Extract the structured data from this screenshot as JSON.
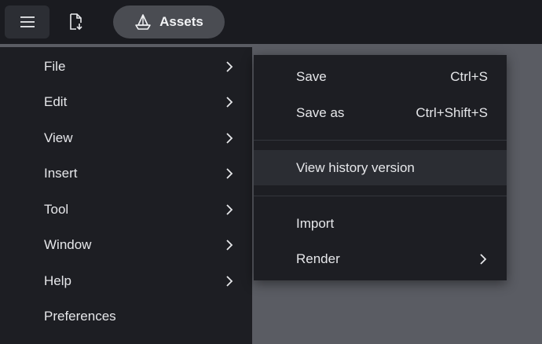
{
  "topbar": {
    "menu_icon": "hamburger-icon",
    "export_icon": "file-export-icon",
    "assets_icon": "boat-icon",
    "assets_label": "Assets"
  },
  "main_menu": {
    "items": [
      {
        "label": "File",
        "has_submenu": true
      },
      {
        "label": "Edit",
        "has_submenu": true
      },
      {
        "label": "View",
        "has_submenu": true
      },
      {
        "label": "Insert",
        "has_submenu": true
      },
      {
        "label": "Tool",
        "has_submenu": true
      },
      {
        "label": "Window",
        "has_submenu": true
      },
      {
        "label": "Help",
        "has_submenu": true
      },
      {
        "label": "Preferences",
        "has_submenu": false
      }
    ]
  },
  "file_submenu": {
    "save": {
      "label": "Save",
      "shortcut": "Ctrl+S"
    },
    "save_as": {
      "label": "Save as",
      "shortcut": "Ctrl+Shift+S"
    },
    "history": {
      "label": "View history version"
    },
    "import": {
      "label": "Import"
    },
    "render": {
      "label": "Render"
    }
  },
  "colors": {
    "menu_bg": "#1d1e23",
    "topbar_bg": "#1a1b20",
    "highlight": "#2b2d33",
    "backdrop": "#5a5c63"
  }
}
